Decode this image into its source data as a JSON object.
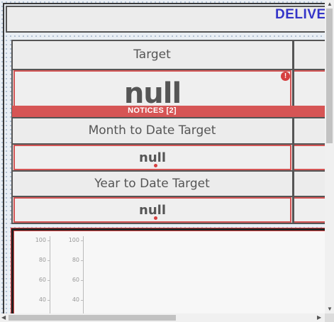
{
  "header": {
    "title": "DELIVEF"
  },
  "rows": [
    {
      "label": "Target",
      "value": "null"
    },
    {
      "label": "Month to Date Target",
      "value": "null"
    },
    {
      "label": "Year to Date Target",
      "value": "null"
    }
  ],
  "notices": {
    "label": "NOTICES [2]",
    "alert_icon": "!"
  },
  "charts": {
    "left_axis_ticks": [
      "100",
      "80",
      "60",
      "40"
    ],
    "right_axis_ticks": [
      "100",
      "80",
      "60",
      "40"
    ]
  },
  "colors": {
    "title": "#3434c8",
    "alert": "#d64040",
    "notice_bar": "#d65555",
    "grid_bg": "#ececec"
  }
}
